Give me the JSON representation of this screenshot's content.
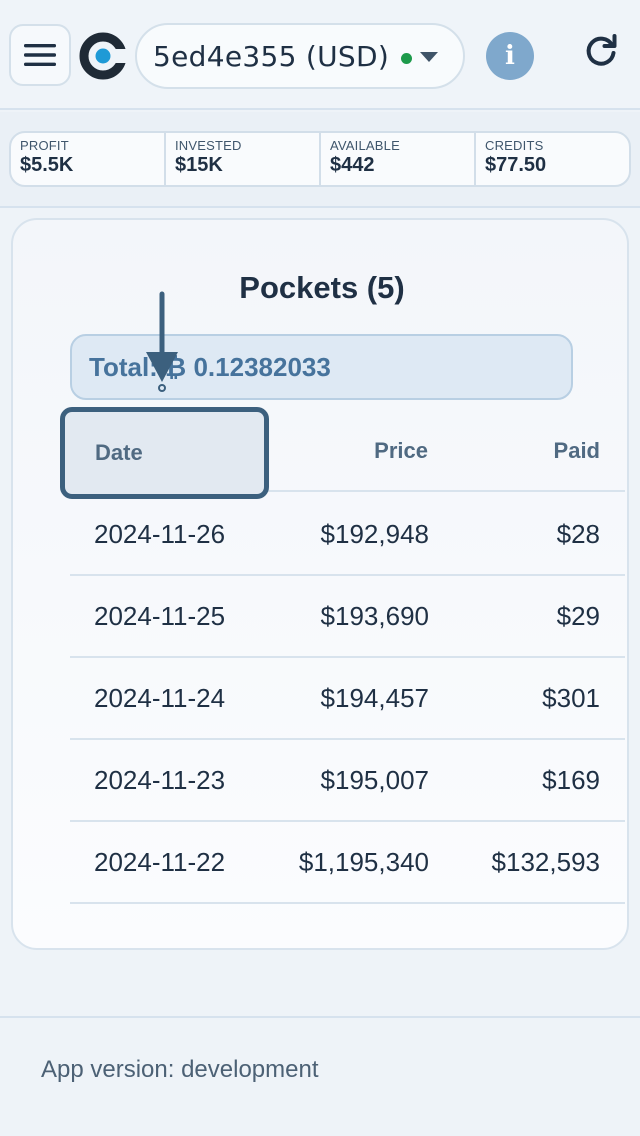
{
  "header": {
    "menu_icon": "hamburger-icon",
    "logo_icon": "app-logo",
    "account_label": "5ed4e355 (USD)",
    "status_color": "#1d9a4b",
    "info_label": "i",
    "refresh_icon": "refresh-icon"
  },
  "stats": [
    {
      "label": "PROFIT",
      "value": "$5.5K"
    },
    {
      "label": "INVESTED",
      "value": "$15K"
    },
    {
      "label": "AVAILABLE",
      "value": "$442"
    },
    {
      "label": "CREDITS",
      "value": "$77.50"
    }
  ],
  "pockets": {
    "title": "Pockets (5)",
    "total_label": "Total: ₿ 0.12382033",
    "columns": [
      "Date",
      "Price",
      "Paid"
    ],
    "rows": [
      {
        "date": "2024-11-26",
        "price": "$192,948",
        "paid": "$28"
      },
      {
        "date": "2024-11-25",
        "price": "$193,690",
        "paid": "$29"
      },
      {
        "date": "2024-11-24",
        "price": "$194,457",
        "paid": "$301"
      },
      {
        "date": "2024-11-23",
        "price": "$195,007",
        "paid": "$169"
      },
      {
        "date": "2024-11-22",
        "price": "$1,195,340",
        "paid": "$132,593"
      }
    ]
  },
  "footer": {
    "version": "App version: development"
  }
}
